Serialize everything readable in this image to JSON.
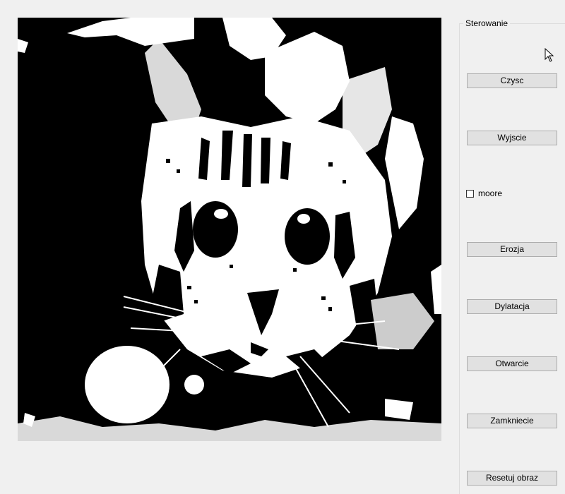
{
  "image": {
    "content": "Binarized black-and-white photo of a kitten's face",
    "colors": {
      "foreground": "#ffffff",
      "background": "#000000"
    }
  },
  "controls": {
    "group_title": "Sterowanie",
    "buttons": {
      "clear": "Czysc",
      "exit": "Wyjscie",
      "erosion": "Erozja",
      "dilation": "Dylatacja",
      "opening": "Otwarcie",
      "closing": "Zamkniecie",
      "reset": "Resetuj obraz"
    },
    "checkbox": {
      "label": "moore",
      "checked": false
    }
  },
  "icons": {
    "cursor": "mouse-pointer-icon"
  },
  "colors": {
    "window_bg": "#f0f0f0",
    "button_bg": "#e1e1e1",
    "button_border": "#adadad"
  }
}
